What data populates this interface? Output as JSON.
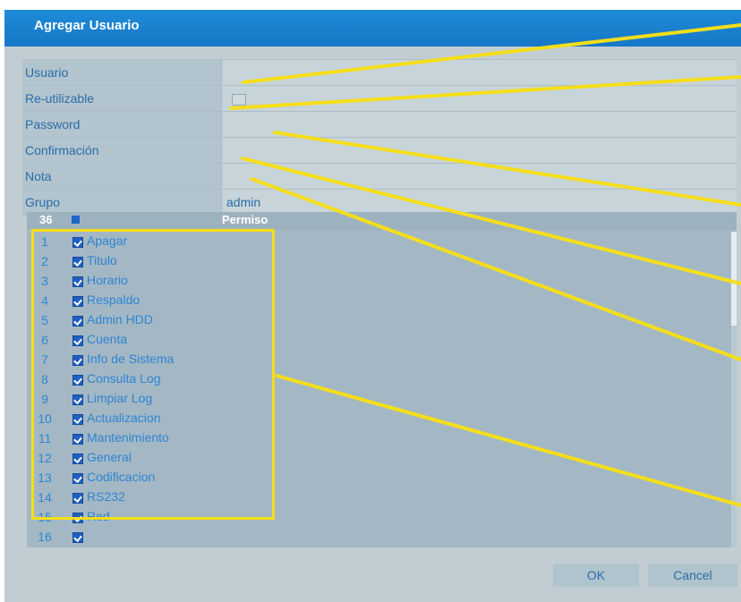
{
  "dialog": {
    "title": "Agregar Usuario"
  },
  "form": {
    "fields": [
      {
        "label": "Usuario",
        "value": ""
      },
      {
        "label": "Re-utilizable",
        "value": ""
      },
      {
        "label": "Password",
        "value": ""
      },
      {
        "label": "Confirmación",
        "value": ""
      },
      {
        "label": "Nota",
        "value": ""
      },
      {
        "label": "Grupo",
        "value": "admin"
      }
    ]
  },
  "permissions": {
    "header": {
      "num": "36",
      "title": "Permiso"
    },
    "items": [
      {
        "num": "1",
        "label": "Apagar"
      },
      {
        "num": "2",
        "label": "Titulo"
      },
      {
        "num": "3",
        "label": "Horario"
      },
      {
        "num": "4",
        "label": "Respaldo"
      },
      {
        "num": "5",
        "label": "Admin HDD"
      },
      {
        "num": "6",
        "label": "Cuenta"
      },
      {
        "num": "7",
        "label": "Info de Sistema"
      },
      {
        "num": "8",
        "label": "Consulta Log"
      },
      {
        "num": "9",
        "label": "Limpiar Log"
      },
      {
        "num": "10",
        "label": "Actualizacion"
      },
      {
        "num": "11",
        "label": "Mantenimiento"
      },
      {
        "num": "12",
        "label": "General"
      },
      {
        "num": "13",
        "label": "Codificacion"
      },
      {
        "num": "14",
        "label": "RS232"
      },
      {
        "num": "15",
        "label": "Red"
      },
      {
        "num": "16",
        "label": ""
      }
    ]
  },
  "buttons": {
    "ok": "OK",
    "cancel": "Cancel"
  },
  "colors": {
    "titlebar": "#1a82d0",
    "annotation": "#f5de1a",
    "checkbox": "#1f5fc2"
  }
}
